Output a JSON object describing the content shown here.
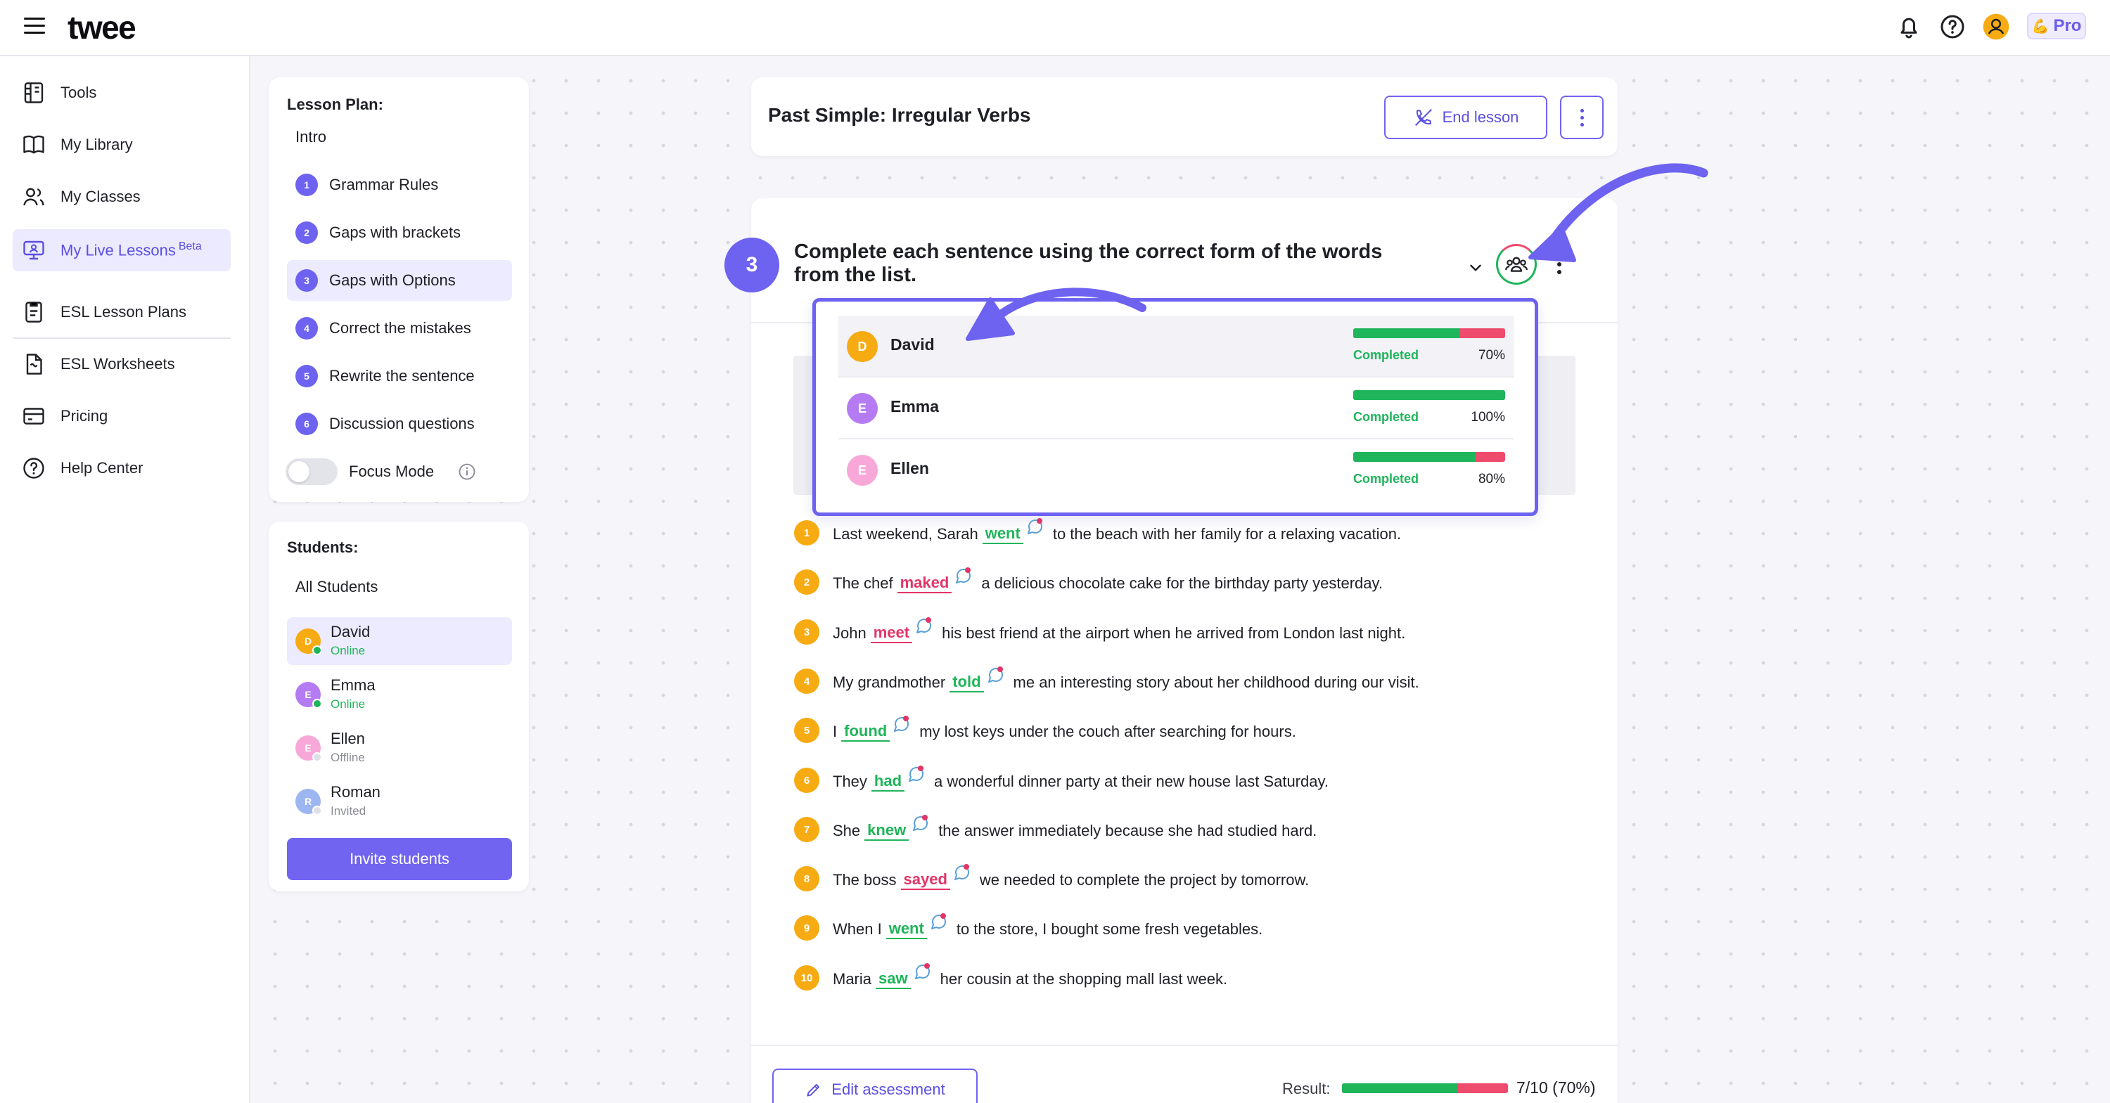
{
  "header": {
    "logo": "twee",
    "plan_label": "Pro",
    "plan_emoji": "💪",
    "icons": [
      "menu-icon",
      "bell-icon",
      "help-icon",
      "user-icon"
    ]
  },
  "nav": {
    "items": [
      {
        "label": "Tools",
        "icon": "tools-icon"
      },
      {
        "label": "My Library",
        "icon": "book-icon"
      },
      {
        "label": "My Classes",
        "icon": "users-icon"
      },
      {
        "label": "My Live Lessons",
        "icon": "monitor-icon",
        "badge": "Beta"
      },
      {
        "label": "ESL Lesson Plans",
        "icon": "lesson-plan-icon"
      },
      {
        "label": "ESL Worksheets",
        "icon": "worksheet-icon"
      },
      {
        "label": "Pricing",
        "icon": "card-icon"
      },
      {
        "label": "Help Center",
        "icon": "help-icon"
      }
    ]
  },
  "lesson_plan": {
    "title": "Lesson Plan:",
    "intro": "Intro",
    "steps": [
      {
        "num": "1",
        "label": "Grammar Rules"
      },
      {
        "num": "2",
        "label": "Gaps with brackets"
      },
      {
        "num": "3",
        "label": "Gaps with Options"
      },
      {
        "num": "4",
        "label": "Correct the mistakes"
      },
      {
        "num": "5",
        "label": "Rewrite the sentence"
      },
      {
        "num": "6",
        "label": "Discussion questions"
      }
    ],
    "focus_mode": "Focus Mode"
  },
  "students": {
    "title": "Students:",
    "all": "All Students",
    "list": [
      {
        "initial": "D",
        "name": "David",
        "status": "Online",
        "color": "#f6ab13",
        "status_color": "#1fb55a"
      },
      {
        "initial": "E",
        "name": "Emma",
        "status": "Online",
        "color": "#b57bf2",
        "status_color": "#1fb55a"
      },
      {
        "initial": "E",
        "name": "Ellen",
        "status": "Offline",
        "color": "#f7a8d8",
        "status_color": "#c9c9d3"
      },
      {
        "initial": "R",
        "name": "Roman",
        "status": "Invited",
        "color": "#9db6f2",
        "status_color": "#c9c9d3"
      }
    ],
    "invite_label": "Invite students"
  },
  "lesson": {
    "title": "Past Simple: Irregular Verbs",
    "end_label": "End lesson"
  },
  "exercise": {
    "number": "3",
    "title": "Complete each sentence using the correct form of the words from the list.",
    "progress": [
      {
        "initial": "D",
        "name": "David",
        "status": "Completed",
        "percent": "70%",
        "fraction": 0.7,
        "color": "#f6ab13"
      },
      {
        "initial": "E",
        "name": "Emma",
        "status": "Completed",
        "percent": "100%",
        "fraction": 1.0,
        "color": "#b57bf2"
      },
      {
        "initial": "E",
        "name": "Ellen",
        "status": "Completed",
        "percent": "80%",
        "fraction": 0.8,
        "color": "#f7a8d8"
      }
    ],
    "sentences": [
      {
        "num": "1",
        "before": "Last weekend, Sarah",
        "answer": "went",
        "correct": true,
        "after": "to the beach with her family for a relaxing vacation."
      },
      {
        "num": "2",
        "before": "The chef",
        "answer": "maked",
        "correct": false,
        "after": "a delicious chocolate cake for the birthday party yesterday."
      },
      {
        "num": "3",
        "before": "John",
        "answer": "meet",
        "correct": false,
        "after": "his best friend at the airport when he arrived from London last night."
      },
      {
        "num": "4",
        "before": "My grandmother",
        "answer": "told",
        "correct": true,
        "after": "me an interesting story about her childhood during our visit."
      },
      {
        "num": "5",
        "before": "I",
        "answer": "found",
        "correct": true,
        "after": "my lost keys under the couch after searching for hours."
      },
      {
        "num": "6",
        "before": "They",
        "answer": "had",
        "correct": true,
        "after": "a wonderful dinner party at their new house last Saturday."
      },
      {
        "num": "7",
        "before": "She",
        "answer": "knew",
        "correct": true,
        "after": "the answer immediately because she had studied hard."
      },
      {
        "num": "8",
        "before": "The boss",
        "answer": "sayed",
        "correct": false,
        "after": "we needed to complete the project by tomorrow."
      },
      {
        "num": "9",
        "before": "When I",
        "answer": "went",
        "correct": true,
        "after": "to the store, I bought some fresh vegetables."
      },
      {
        "num": "10",
        "before": "Maria",
        "answer": "saw",
        "correct": true,
        "after": "her cousin at the shopping mall last week."
      }
    ],
    "edit_label": "Edit assessment",
    "result_label": "Result:",
    "result_value": "7/10 (70%)",
    "result_fraction": 0.7
  }
}
